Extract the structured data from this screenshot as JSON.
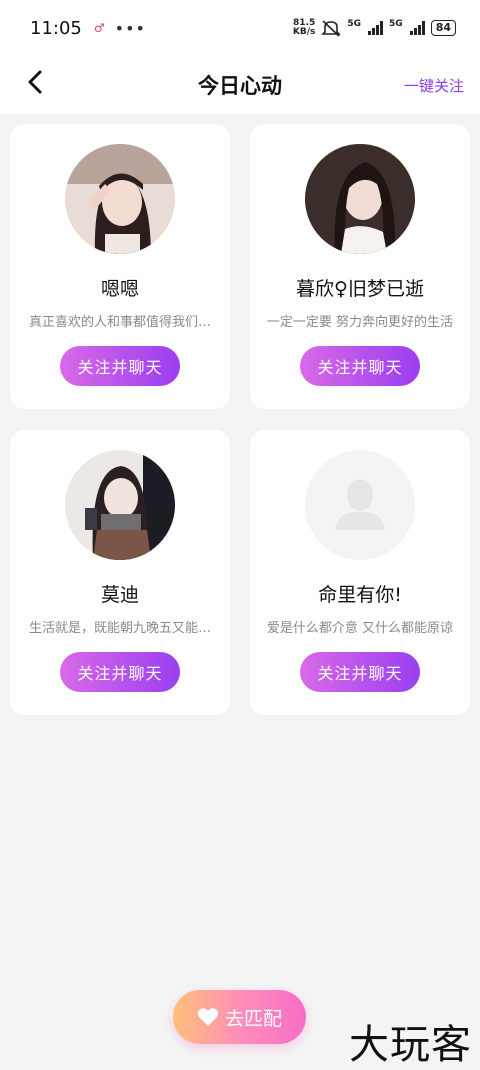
{
  "status_bar": {
    "time": "11:05",
    "net_speed_value": "81.5",
    "net_speed_unit": "KB/s",
    "sig1_label": "5G",
    "sig2_label": "5G",
    "battery": "84"
  },
  "header": {
    "title": "今日心动",
    "follow_all": "一键关注"
  },
  "cards": [
    {
      "name": "嗯嗯",
      "bio": "真正喜欢的人和事都值得我们…",
      "button": "关注并聊天"
    },
    {
      "name": "暮欣♀旧梦已逝",
      "bio": "一定一定要 努力奔向更好的生活",
      "button": "关注并聊天"
    },
    {
      "name": "莫迪",
      "bio": "生活就是，既能朝九晚五又能…",
      "button": "关注并聊天"
    },
    {
      "name": "命里有你!",
      "bio": "爱是什么都介意 又什么都能原谅",
      "button": "关注并聊天"
    }
  ],
  "match_button": {
    "label": "去匹配"
  },
  "watermark": "大玩客",
  "colors": {
    "accent_purple": "#8d3ee8",
    "button_gradient_start": "#d86ae8",
    "button_gradient_end": "#9a3ef0",
    "background": "#f4f4f4"
  }
}
